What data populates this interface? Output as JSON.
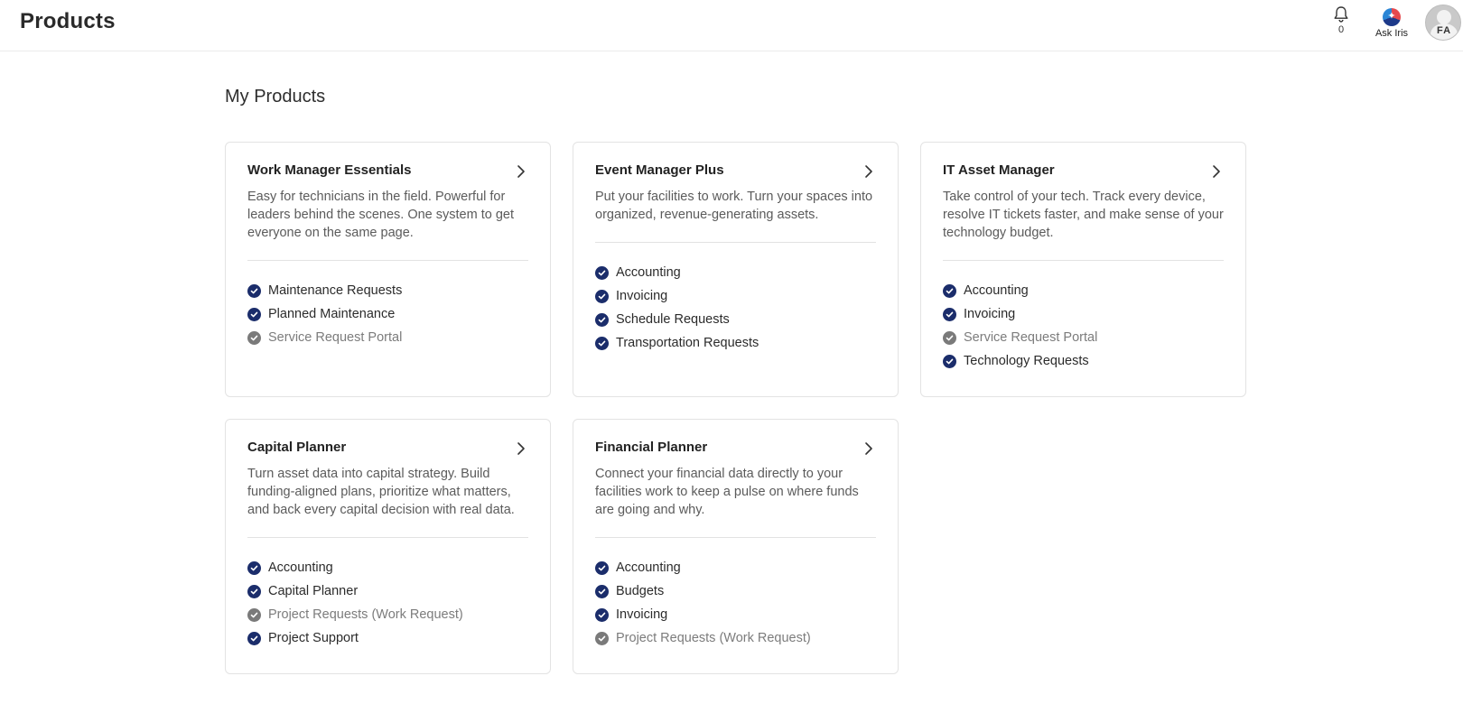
{
  "header": {
    "title": "Products",
    "notifications": {
      "icon": "bell-icon",
      "count": "0"
    },
    "ask_iris": {
      "icon": "iris-icon",
      "label": "Ask Iris"
    },
    "avatar": {
      "initials": "FA"
    }
  },
  "section_title": "My Products",
  "colors": {
    "check_enabled": "#1b2d6b",
    "check_disabled": "#7a7a7a",
    "disabled_text": "#7c7c7c"
  },
  "products": [
    {
      "title": "Work Manager Essentials",
      "description": "Easy for technicians in the field. Powerful for leaders behind the scenes. One system to get everyone on the same page.",
      "features": [
        {
          "label": "Maintenance Requests",
          "enabled": true
        },
        {
          "label": "Planned Maintenance",
          "enabled": true
        },
        {
          "label": "Service Request Portal",
          "enabled": false
        }
      ]
    },
    {
      "title": "Event Manager Plus",
      "description": "Put your facilities to work. Turn your spaces into organized, revenue-generating assets.",
      "features": [
        {
          "label": "Accounting",
          "enabled": true
        },
        {
          "label": "Invoicing",
          "enabled": true
        },
        {
          "label": "Schedule Requests",
          "enabled": true
        },
        {
          "label": "Transportation Requests",
          "enabled": true
        }
      ]
    },
    {
      "title": "IT Asset Manager",
      "description": "Take control of your tech. Track every device, resolve IT tickets faster, and make sense of your technology budget.",
      "features": [
        {
          "label": "Accounting",
          "enabled": true
        },
        {
          "label": "Invoicing",
          "enabled": true
        },
        {
          "label": "Service Request Portal",
          "enabled": false
        },
        {
          "label": "Technology Requests",
          "enabled": true
        }
      ]
    },
    {
      "title": "Capital Planner",
      "description": "Turn asset data into capital strategy. Build funding-aligned plans, prioritize what matters, and back every capital decision with real data.",
      "features": [
        {
          "label": "Accounting",
          "enabled": true
        },
        {
          "label": "Capital Planner",
          "enabled": true
        },
        {
          "label": "Project Requests (Work Request)",
          "enabled": false
        },
        {
          "label": "Project Support",
          "enabled": true
        }
      ]
    },
    {
      "title": "Financial Planner",
      "description": "Connect your financial data directly to your facilities work to keep a pulse on where funds are going and why.",
      "features": [
        {
          "label": "Accounting",
          "enabled": true
        },
        {
          "label": "Budgets",
          "enabled": true
        },
        {
          "label": "Invoicing",
          "enabled": true
        },
        {
          "label": "Project Requests (Work Request)",
          "enabled": false
        }
      ]
    }
  ]
}
